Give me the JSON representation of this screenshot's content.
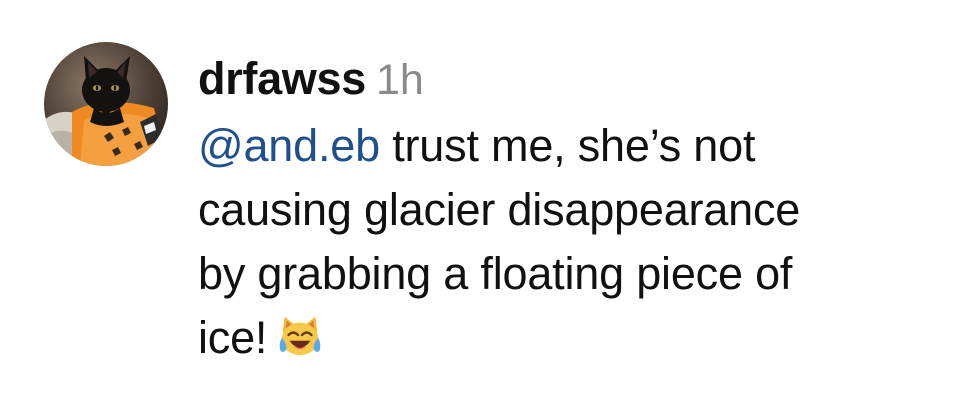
{
  "comment": {
    "username": "drfawss",
    "timestamp": "1h",
    "mention": "@and.eb",
    "lines": [
      " trust me, she’s not",
      "causing glacier disappearance",
      "by grabbing a floating piece of",
      "ice!"
    ],
    "emoji_icon": "cat-face-tears-of-joy-icon",
    "avatar_icon": "black-cat-in-orange-sweater-avatar"
  },
  "colors": {
    "text": "#111111",
    "timestamp": "#8a8a8a",
    "mention": "#1f4f8c",
    "background": "#ffffff"
  }
}
